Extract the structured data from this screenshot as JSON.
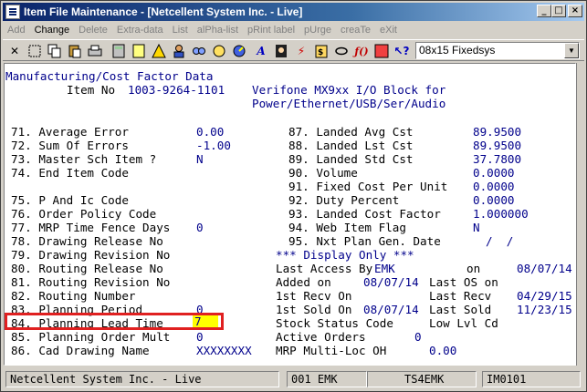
{
  "window": {
    "title": "Item File Maintenance - [Netcellent System Inc. - Live]"
  },
  "menu": [
    "Add",
    "Change",
    "Delete",
    "Extra-data",
    "List",
    "alPha-list",
    "pRint label",
    "pUrge",
    "creaTe",
    "eXit"
  ],
  "menu_enabled": [
    "Change"
  ],
  "toolbar": {
    "icons": [
      "cut-icon",
      "select-icon",
      "copy-icon",
      "paste-icon",
      "print-icon",
      "calc-icon",
      "note-icon",
      "warning-icon",
      "user-icon",
      "search-icon",
      "globe-icon",
      "font-icon",
      "dial-icon",
      "lightning-icon",
      "clipboard-icon",
      "link-icon",
      "function-icon",
      "book-icon",
      "help-cursor-icon",
      "hatched-icon"
    ],
    "font_select": "08x15 Fixedsys"
  },
  "screen": {
    "heading": "Manufacturing/Cost Factor Data",
    "item_label": "Item No",
    "item_no": "1003-9264-1101",
    "desc1": "Verifone MX9xx I/O Block for",
    "desc2": "Power/Ethernet/USB/Ser/Audio",
    "left_fields": [
      {
        "label": "71. Average Error",
        "value": "0.00"
      },
      {
        "label": "72. Sum Of Errors",
        "value": "-1.00"
      },
      {
        "label": "73. Master Sch Item ?",
        "value": "N"
      },
      {
        "label": "74. End Item Code",
        "value": ""
      },
      {
        "label": "",
        "value": ""
      },
      {
        "label": "75. P And Ic Code",
        "value": ""
      },
      {
        "label": "76. Order Policy Code",
        "value": ""
      },
      {
        "label": "77. MRP Time Fence Days",
        "value": "0"
      },
      {
        "label": "78. Drawing Release No",
        "value": ""
      },
      {
        "label": "79. Drawing Revision No",
        "value": ""
      },
      {
        "label": "80. Routing Release No",
        "value": ""
      },
      {
        "label": "81. Routing Revision No",
        "value": ""
      },
      {
        "label": "82. Routing Number",
        "value": ""
      },
      {
        "label": "83. Planning Period",
        "value": "0"
      },
      {
        "label": "84. Planning Lead Time",
        "value": "7"
      },
      {
        "label": "85. Planning Order Mult",
        "value": "0"
      },
      {
        "label": "86. Cad Drawing Name",
        "value": "XXXXXXXX"
      }
    ],
    "right_fields": [
      {
        "label": "87. Landed Avg Cst",
        "value": "89.9500"
      },
      {
        "label": "88. Landed Lst Cst",
        "value": "89.9500"
      },
      {
        "label": "89. Landed Std Cst",
        "value": "37.7800"
      },
      {
        "label": "90. Volume",
        "value": "0.0000"
      },
      {
        "label": "91. Fixed Cost Per Unit",
        "value": "0.0000"
      },
      {
        "label": "92. Duty Percent",
        "value": "0.0000"
      },
      {
        "label": "93. Landed Cost Factor",
        "value": "1.000000"
      },
      {
        "label": "94. Web Item Flag",
        "value": "N"
      },
      {
        "label": "95. Nxt Plan Gen. Date",
        "value": "/  /"
      }
    ],
    "display_only": "*** Display Only ***",
    "info": {
      "last_access_label": "Last Access By",
      "last_access_user": "EMK",
      "on_label": "on",
      "last_access_date": "08/07/14",
      "added_label": "Added on",
      "added_date": "08/07/14",
      "last_os_label": "Last OS on",
      "first_recv_label": "1st Recv On",
      "last_recv_label": "Last Recv",
      "last_recv_date": "04/29/15",
      "first_sold_label": "1st Sold On",
      "first_sold_date": "08/07/14",
      "last_sold_label": "Last Sold",
      "last_sold_date": "11/23/15",
      "stock_status_label": "Stock Status Code",
      "low_lvl_label": "Low Lvl Cd",
      "active_orders_label": "Active Orders",
      "active_orders_value": "0",
      "mrp_label": "MRP Multi-Loc OH",
      "mrp_value": "0.00"
    }
  },
  "status": {
    "company": "Netcellent System Inc. - Live",
    "user": "001 EMK",
    "terminal": "TS4EMK",
    "program": "IM0101"
  }
}
